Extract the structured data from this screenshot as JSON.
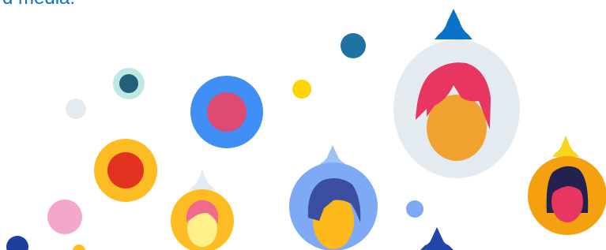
{
  "headline": "d media.",
  "colors": {
    "text_blue": "#0a73c8",
    "pin_blue": "#0a73c8",
    "pin_navy": "#1f46a8",
    "pin_light_blue": "#9fc4f4",
    "pin_light_grey": "#e4ebf0",
    "pin_yellow": "#fbd51c",
    "grey_disc": "#e4ebf0",
    "periwinkle": "#7ea9f4",
    "bright_blue": "#3f8ff7",
    "orange": "#f4a00f",
    "amber": "#fdbc22",
    "red": "#e1331f",
    "pink": "#f3a7c9",
    "mint": "#bde9e2",
    "teal": "#23607b",
    "yellow": "#ffd400",
    "skin": "#efa22f",
    "hair_pink": "#e7365f",
    "hair_navy": "#3b4ea1",
    "hair_dark": "#22214f"
  },
  "icons": {
    "avatar_1": "woman-avatar-icon",
    "avatar_2": "man-avatar-icon",
    "avatar_3": "woman-avatar-icon",
    "avatar_4": "woman-avatar-icon"
  }
}
